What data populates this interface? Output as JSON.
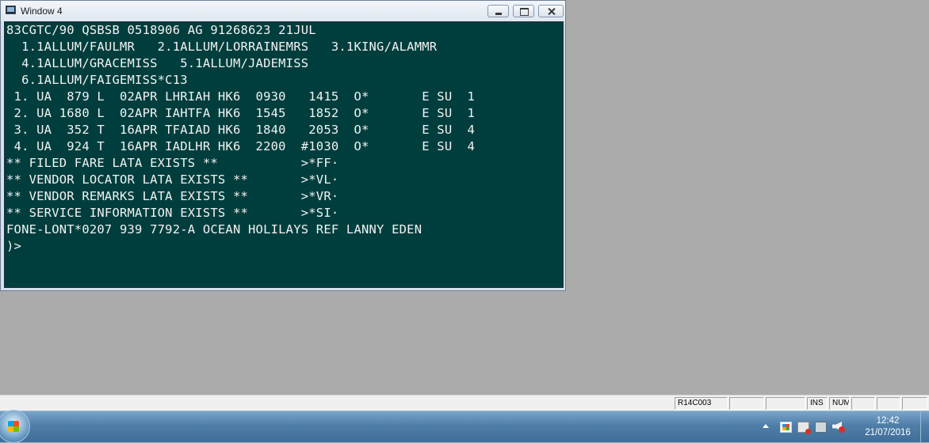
{
  "window": {
    "title": "Window 4"
  },
  "terminal": {
    "lines": [
      "83CGTC/90 QSBSB 0518906 AG 91268623 21JUL",
      "  1.1ALLUM/FAULMR   2.1ALLUM/LORRAINEMRS   3.1KING/ALAMMR",
      "  4.1ALLUM/GRACEMISS   5.1ALLUM/JADEMISS",
      "  6.1ALLUM/FAIGEMISS*C13",
      " 1. UA  879 L  02APR LHRIAH HK6  0930   1415  O*       E SU  1",
      " 2. UA 1680 L  02APR IAHTFA HK6  1545   1852  O*       E SU  1",
      " 3. UA  352 T  16APR TFAIAD HK6  1840   2053  O*       E SU  4",
      " 4. UA  924 T  16APR IADLHR HK6  2200  #1030  O*       E SU  4",
      "** FILED FARE LATA EXISTS **           >*FF·",
      "** VENDOR LOCATOR LATA EXISTS **       >*VL·",
      "** VENDOR REMARKS LATA EXISTS **       >*VR·",
      "** SERVICE INFORMATION EXISTS **       >*SI·",
      "FONE-LONT*0207 939 7792-A OCEAN HOLILAYS REF LANNY EDEN",
      ")>"
    ],
    "colors": {
      "background": "#003e3d",
      "text": "#f2f2f2"
    }
  },
  "statusbar": {
    "position": "R14C003",
    "ins": "INS",
    "num": "NUM"
  },
  "taskbar": {
    "time": "12:42",
    "date": "21/07/2016"
  }
}
